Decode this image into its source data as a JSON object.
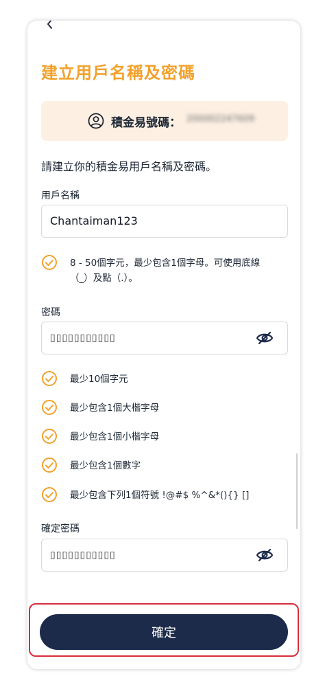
{
  "header": {
    "title": "建立用戶名稱及密碼"
  },
  "account": {
    "label": "積金易號碼：",
    "number": "200002247609"
  },
  "instruction": "請建立你的積金易用戶名稱及密碼。",
  "username": {
    "label": "用戶名稱",
    "value": "Chantaiman123",
    "rule": "8 - 50個字元，最少包含1個字母。可使用底線（_）及點（.）。"
  },
  "password": {
    "label": "密碼",
    "masked_value": "▯▯▯▯▯▯▯▯▯▯▯",
    "rules": [
      "最少10個字元",
      "最少包含1個大楷字母",
      "最少包含1個小楷字母",
      "最少包含1個數字",
      "最少包含下列1個符號 !@#$ %^&*(){} []"
    ]
  },
  "confirm_password": {
    "label": "確定密碼",
    "masked_value": "▯▯▯▯▯▯▯▯▯▯▯"
  },
  "actions": {
    "confirm_label": "確定"
  },
  "colors": {
    "accent": "#f2a12b",
    "button": "#1c2b4a",
    "highlight": "#d62d3a",
    "account_bg": "#fdf0e3"
  }
}
